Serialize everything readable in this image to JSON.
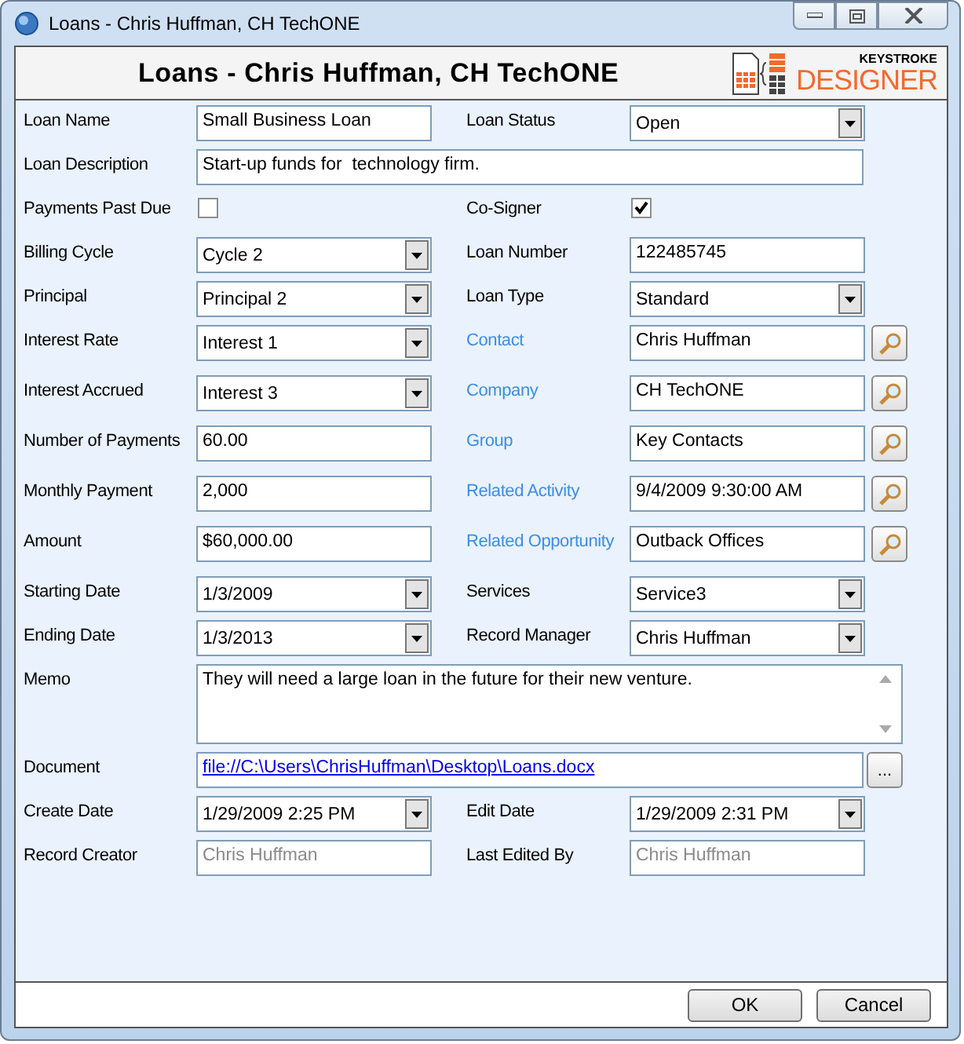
{
  "window": {
    "title": "Loans - Chris Huffman, CH TechONE"
  },
  "header": {
    "title": "Loans - Chris Huffman, CH TechONE",
    "logo_top": "KEYSTROKE",
    "logo_bottom": "DESIGNER"
  },
  "rows": [
    {
      "left": {
        "label": "Loan Name",
        "kind": "text",
        "value": "Small Business Loan"
      },
      "right": {
        "label": "Loan Status",
        "kind": "combo",
        "value": "Open"
      }
    },
    {
      "left": {
        "label": "Loan Description",
        "kind": "wide",
        "value": "Start-up funds for  technology firm."
      }
    },
    {
      "left": {
        "label": "Payments Past Due",
        "kind": "checkbox",
        "checked": false
      },
      "right": {
        "label": "Co-Signer",
        "kind": "checkbox",
        "checked": true
      }
    },
    {
      "left": {
        "label": "Billing Cycle",
        "kind": "combo",
        "value": "Cycle 2"
      },
      "right": {
        "label": "Loan Number",
        "kind": "text",
        "value": "122485745"
      }
    },
    {
      "left": {
        "label": "Principal",
        "kind": "combo",
        "value": "Principal 2"
      },
      "right": {
        "label": "Loan Type",
        "kind": "combo",
        "value": "Standard"
      }
    },
    {
      "left": {
        "label": "Interest Rate",
        "kind": "combo",
        "value": "Interest 1"
      },
      "right": {
        "label": "Contact",
        "kind": "lookup",
        "value": "Chris Huffman"
      }
    },
    {
      "left": {
        "label": "Interest Accrued",
        "kind": "combo",
        "value": "Interest 3"
      },
      "right": {
        "label": "Company",
        "kind": "lookup",
        "value": "CH TechONE"
      }
    },
    {
      "left": {
        "label": "Number of Payments",
        "kind": "text",
        "value": "60.00"
      },
      "right": {
        "label": "Group",
        "kind": "lookup",
        "value": "Key Contacts"
      }
    },
    {
      "left": {
        "label": "Monthly Payment",
        "kind": "text",
        "value": "2,000"
      },
      "right": {
        "label": "Related Activity",
        "kind": "lookup",
        "value": "9/4/2009 9:30:00 AM"
      }
    },
    {
      "left": {
        "label": "Amount",
        "kind": "text",
        "value": "$60,000.00"
      },
      "right": {
        "label": "Related Opportunity",
        "kind": "lookup",
        "value": "Outback Offices"
      }
    },
    {
      "left": {
        "label": "Starting Date",
        "kind": "combo",
        "value": "1/3/2009"
      },
      "right": {
        "label": "Services",
        "kind": "combo",
        "value": "Service3"
      }
    },
    {
      "left": {
        "label": "Ending Date",
        "kind": "combo",
        "value": "1/3/2013"
      },
      "right": {
        "label": "Record Manager",
        "kind": "combo",
        "value": "Chris Huffman"
      }
    },
    {
      "left": {
        "label": "Memo",
        "kind": "memo",
        "value": "They will need a large loan in the future for their new venture."
      }
    },
    {
      "left": {
        "label": "Document",
        "kind": "file",
        "value": "file://C:\\Users\\ChrisHuffman\\Desktop\\Loans.docx",
        "button": "..."
      }
    },
    {
      "left": {
        "label": "Create Date",
        "kind": "combo",
        "value": "1/29/2009 2:25 PM"
      },
      "right": {
        "label": "Edit Date",
        "kind": "combo",
        "value": "1/29/2009 2:31 PM"
      }
    },
    {
      "left": {
        "label": "Record Creator",
        "kind": "readonly",
        "value": "Chris Huffman"
      },
      "right": {
        "label": "Last Edited By",
        "kind": "readonly",
        "value": "Chris Huffman"
      }
    }
  ],
  "buttons": [
    "OK",
    "Cancel"
  ]
}
